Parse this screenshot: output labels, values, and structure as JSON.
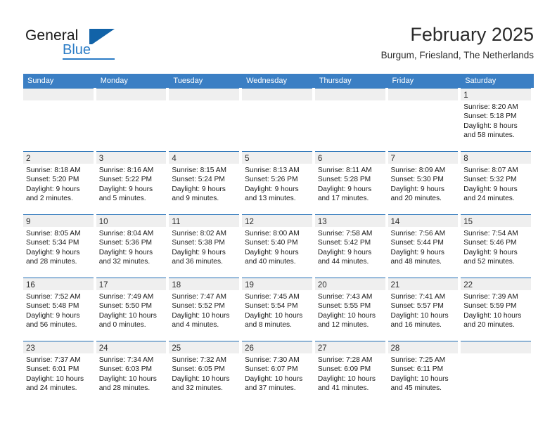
{
  "brand": {
    "name_part1": "General",
    "name_part2": "Blue",
    "logo_icon": "triangle-flag-icon"
  },
  "header": {
    "title": "February 2025",
    "subtitle": "Burgum, Friesland, The Netherlands"
  },
  "colors": {
    "header_blue": "#3b7fc4",
    "cell_rule_blue": "#1d6cb5",
    "daynum_band": "#efefef",
    "brand_blue": "#2b7cc6",
    "brand_dark_blue": "#1263a8"
  },
  "weekdays": [
    "Sunday",
    "Monday",
    "Tuesday",
    "Wednesday",
    "Thursday",
    "Friday",
    "Saturday"
  ],
  "labels": {
    "sunrise_prefix": "Sunrise:",
    "sunset_prefix": "Sunset:",
    "daylight_prefix": "Daylight:"
  },
  "weeks": [
    [
      {
        "empty": true
      },
      {
        "empty": true
      },
      {
        "empty": true
      },
      {
        "empty": true
      },
      {
        "empty": true
      },
      {
        "empty": true
      },
      {
        "day": "1",
        "sunrise": "Sunrise: 8:20 AM",
        "sunset": "Sunset: 5:18 PM",
        "daylight": "Daylight: 8 hours and 58 minutes."
      }
    ],
    [
      {
        "day": "2",
        "sunrise": "Sunrise: 8:18 AM",
        "sunset": "Sunset: 5:20 PM",
        "daylight": "Daylight: 9 hours and 2 minutes."
      },
      {
        "day": "3",
        "sunrise": "Sunrise: 8:16 AM",
        "sunset": "Sunset: 5:22 PM",
        "daylight": "Daylight: 9 hours and 5 minutes."
      },
      {
        "day": "4",
        "sunrise": "Sunrise: 8:15 AM",
        "sunset": "Sunset: 5:24 PM",
        "daylight": "Daylight: 9 hours and 9 minutes."
      },
      {
        "day": "5",
        "sunrise": "Sunrise: 8:13 AM",
        "sunset": "Sunset: 5:26 PM",
        "daylight": "Daylight: 9 hours and 13 minutes."
      },
      {
        "day": "6",
        "sunrise": "Sunrise: 8:11 AM",
        "sunset": "Sunset: 5:28 PM",
        "daylight": "Daylight: 9 hours and 17 minutes."
      },
      {
        "day": "7",
        "sunrise": "Sunrise: 8:09 AM",
        "sunset": "Sunset: 5:30 PM",
        "daylight": "Daylight: 9 hours and 20 minutes."
      },
      {
        "day": "8",
        "sunrise": "Sunrise: 8:07 AM",
        "sunset": "Sunset: 5:32 PM",
        "daylight": "Daylight: 9 hours and 24 minutes."
      }
    ],
    [
      {
        "day": "9",
        "sunrise": "Sunrise: 8:05 AM",
        "sunset": "Sunset: 5:34 PM",
        "daylight": "Daylight: 9 hours and 28 minutes."
      },
      {
        "day": "10",
        "sunrise": "Sunrise: 8:04 AM",
        "sunset": "Sunset: 5:36 PM",
        "daylight": "Daylight: 9 hours and 32 minutes."
      },
      {
        "day": "11",
        "sunrise": "Sunrise: 8:02 AM",
        "sunset": "Sunset: 5:38 PM",
        "daylight": "Daylight: 9 hours and 36 minutes."
      },
      {
        "day": "12",
        "sunrise": "Sunrise: 8:00 AM",
        "sunset": "Sunset: 5:40 PM",
        "daylight": "Daylight: 9 hours and 40 minutes."
      },
      {
        "day": "13",
        "sunrise": "Sunrise: 7:58 AM",
        "sunset": "Sunset: 5:42 PM",
        "daylight": "Daylight: 9 hours and 44 minutes."
      },
      {
        "day": "14",
        "sunrise": "Sunrise: 7:56 AM",
        "sunset": "Sunset: 5:44 PM",
        "daylight": "Daylight: 9 hours and 48 minutes."
      },
      {
        "day": "15",
        "sunrise": "Sunrise: 7:54 AM",
        "sunset": "Sunset: 5:46 PM",
        "daylight": "Daylight: 9 hours and 52 minutes."
      }
    ],
    [
      {
        "day": "16",
        "sunrise": "Sunrise: 7:52 AM",
        "sunset": "Sunset: 5:48 PM",
        "daylight": "Daylight: 9 hours and 56 minutes."
      },
      {
        "day": "17",
        "sunrise": "Sunrise: 7:49 AM",
        "sunset": "Sunset: 5:50 PM",
        "daylight": "Daylight: 10 hours and 0 minutes."
      },
      {
        "day": "18",
        "sunrise": "Sunrise: 7:47 AM",
        "sunset": "Sunset: 5:52 PM",
        "daylight": "Daylight: 10 hours and 4 minutes."
      },
      {
        "day": "19",
        "sunrise": "Sunrise: 7:45 AM",
        "sunset": "Sunset: 5:54 PM",
        "daylight": "Daylight: 10 hours and 8 minutes."
      },
      {
        "day": "20",
        "sunrise": "Sunrise: 7:43 AM",
        "sunset": "Sunset: 5:55 PM",
        "daylight": "Daylight: 10 hours and 12 minutes."
      },
      {
        "day": "21",
        "sunrise": "Sunrise: 7:41 AM",
        "sunset": "Sunset: 5:57 PM",
        "daylight": "Daylight: 10 hours and 16 minutes."
      },
      {
        "day": "22",
        "sunrise": "Sunrise: 7:39 AM",
        "sunset": "Sunset: 5:59 PM",
        "daylight": "Daylight: 10 hours and 20 minutes."
      }
    ],
    [
      {
        "day": "23",
        "sunrise": "Sunrise: 7:37 AM",
        "sunset": "Sunset: 6:01 PM",
        "daylight": "Daylight: 10 hours and 24 minutes."
      },
      {
        "day": "24",
        "sunrise": "Sunrise: 7:34 AM",
        "sunset": "Sunset: 6:03 PM",
        "daylight": "Daylight: 10 hours and 28 minutes."
      },
      {
        "day": "25",
        "sunrise": "Sunrise: 7:32 AM",
        "sunset": "Sunset: 6:05 PM",
        "daylight": "Daylight: 10 hours and 32 minutes."
      },
      {
        "day": "26",
        "sunrise": "Sunrise: 7:30 AM",
        "sunset": "Sunset: 6:07 PM",
        "daylight": "Daylight: 10 hours and 37 minutes."
      },
      {
        "day": "27",
        "sunrise": "Sunrise: 7:28 AM",
        "sunset": "Sunset: 6:09 PM",
        "daylight": "Daylight: 10 hours and 41 minutes."
      },
      {
        "day": "28",
        "sunrise": "Sunrise: 7:25 AM",
        "sunset": "Sunset: 6:11 PM",
        "daylight": "Daylight: 10 hours and 45 minutes."
      },
      {
        "empty": true
      }
    ]
  ]
}
